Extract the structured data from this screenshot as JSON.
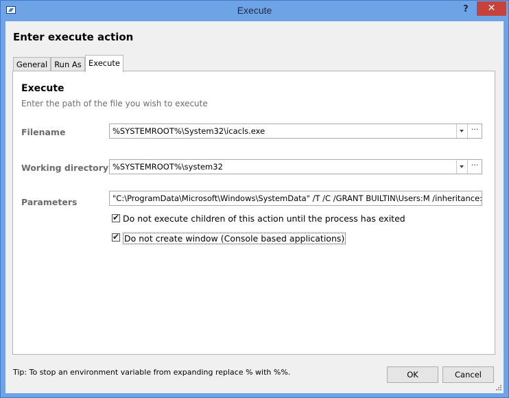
{
  "window": {
    "title": "Execute",
    "help_glyph": "?",
    "close_glyph": "✕"
  },
  "dialog": {
    "heading": "Enter execute action"
  },
  "tabs": [
    {
      "label": "General"
    },
    {
      "label": "Run As"
    },
    {
      "label": "Execute"
    }
  ],
  "panel": {
    "title": "Execute",
    "subtitle": "Enter the path of the file you wish to execute",
    "filename": {
      "label": "Filename",
      "value": "%SYSTEMROOT%\\System32\\icacls.exe"
    },
    "working_directory": {
      "label": "Working directory",
      "value": "%SYSTEMROOT%\\system32"
    },
    "parameters": {
      "label": "Parameters",
      "value": "\"C:\\ProgramData\\Microsoft\\Windows\\SystemData\" /T /C /GRANT BUILTIN\\Users:M /inheritance:e"
    },
    "checkboxes": [
      {
        "label": "Do not execute children of this action until the process has exited",
        "checked": true
      },
      {
        "label": "Do not create window (Console based applications)",
        "checked": true
      }
    ],
    "browse_glyph": "···"
  },
  "footer": {
    "tip": "Tip: To stop an environment variable from expanding replace % with %%.",
    "ok_label": "OK",
    "cancel_label": "Cancel"
  },
  "colors": {
    "titlebar": "#6ea3e6",
    "close": "#c7423b",
    "client": "#f0f0f0"
  }
}
